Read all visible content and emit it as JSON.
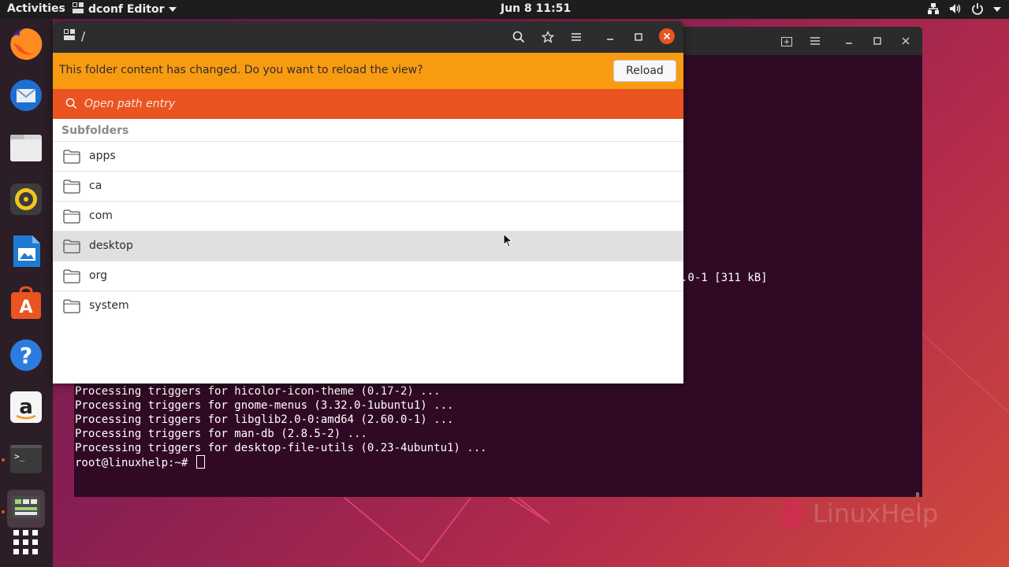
{
  "topbar": {
    "activities": "Activities",
    "app_name": "dconf Editor",
    "clock": "Jun 8  11:51",
    "tray_icons": [
      "network-icon",
      "volume-icon",
      "power-icon"
    ]
  },
  "dock": {
    "items": [
      "firefox",
      "thunderbird",
      "files",
      "rhythmbox",
      "libreoffice-writer",
      "ubuntu-software",
      "help",
      "amazon",
      "terminal",
      "dconf-editor",
      "show-applications"
    ],
    "running": [
      "terminal",
      "dconf-editor"
    ]
  },
  "terminal": {
    "partial_line": ".0-1 [311 kB]",
    "lines": [
      "Processing triggers for hicolor-icon-theme (0.17-2) ...",
      "Processing triggers for gnome-menus (3.32.0-1ubuntu1) ...",
      "Processing triggers for libglib2.0-0:amd64 (2.60.0-1) ...",
      "Processing triggers for man-db (2.8.5-2) ...",
      "Processing triggers for desktop-file-utils (0.23-4ubuntu1) ..."
    ],
    "prompt": "root@linuxhelp:~# "
  },
  "dconf": {
    "path": "/",
    "infobar": {
      "message": "This folder content has changed. Do you want to reload the view?",
      "reload_label": "Reload"
    },
    "search": {
      "placeholder": "Open path entry"
    },
    "subfolders_title": "Subfolders",
    "folders": [
      "apps",
      "ca",
      "com",
      "desktop",
      "org",
      "system"
    ],
    "hovered_folder": "desktop"
  },
  "colors": {
    "ubuntu_orange": "#e95420",
    "infobar_amber": "#f99b11",
    "terminal_bg": "#300a24"
  },
  "watermark": "LinuxHelp"
}
